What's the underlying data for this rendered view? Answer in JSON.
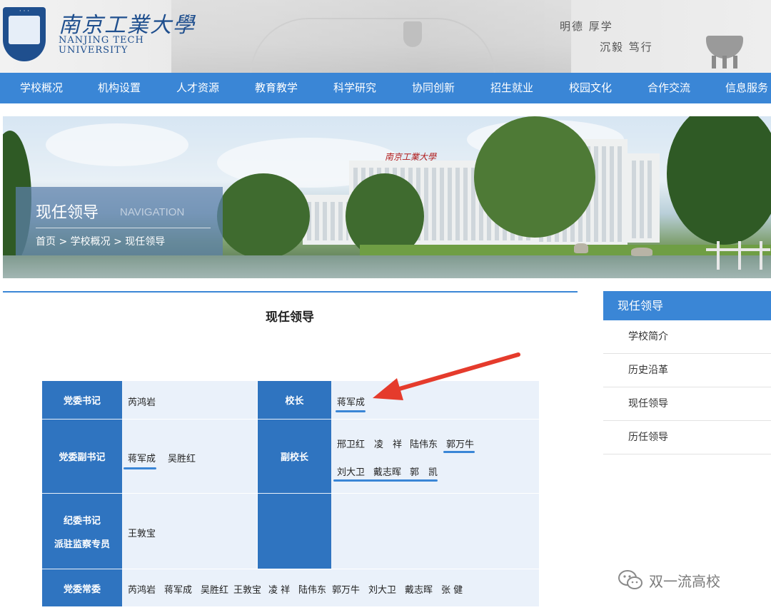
{
  "header": {
    "logo_cn": "南京工業大學",
    "logo_en_line1": "NANJING TECH",
    "logo_en_line2": "UNIVERSITY",
    "motto_line1": "明德 厚学",
    "motto_line2": "沉毅 笃行"
  },
  "nav": {
    "items": [
      "学校概况",
      "机构设置",
      "人才资源",
      "教育教学",
      "科学研究",
      "协同创新",
      "招生就业",
      "校园文化",
      "合作交流",
      "信息服务"
    ]
  },
  "banner": {
    "title": "现任领导",
    "subtitle": "NAVIGATION",
    "breadcrumb": "首页 > 学校概况 > 现任领导"
  },
  "main": {
    "title": "现任领导",
    "table": {
      "r1_h1": "党委书记",
      "r1_v1": "芮鸿岩",
      "r1_h2": "校长",
      "r1_v2": "蒋军成",
      "r2_h1": "党委副书记",
      "r2_v1a": "蒋军成",
      "r2_v1b": "吴胜红",
      "r2_h2": "副校长",
      "r2_v2_line1": [
        "邢卫红",
        "凌　祥",
        "陆伟东",
        "郭万牛"
      ],
      "r2_v2_line2": [
        "刘大卫",
        "戴志晖",
        "郭　凯"
      ],
      "r3_h1_line1": "纪委书记",
      "r3_h1_line2": "派驻监察专员",
      "r3_v1": "王敦宝",
      "r4_h1": "党委常委",
      "r4_members": [
        "芮鸿岩",
        "蒋军成",
        "吴胜红",
        "王敦宝",
        "凌 祥",
        "陆伟东",
        "郭万牛",
        "刘大卫",
        "戴志晖",
        "张 健"
      ]
    }
  },
  "sidebar": {
    "head": "现任领导",
    "items": [
      "学校简介",
      "历史沿革",
      "现任领导",
      "历任领导"
    ]
  },
  "watermark": {
    "text": "双一流高校"
  },
  "colors": {
    "nav_blue": "#3a86d6",
    "header_cell": "#2f74c0",
    "table_bg": "#eaf1fa",
    "arrow_red": "#e53b2c"
  }
}
